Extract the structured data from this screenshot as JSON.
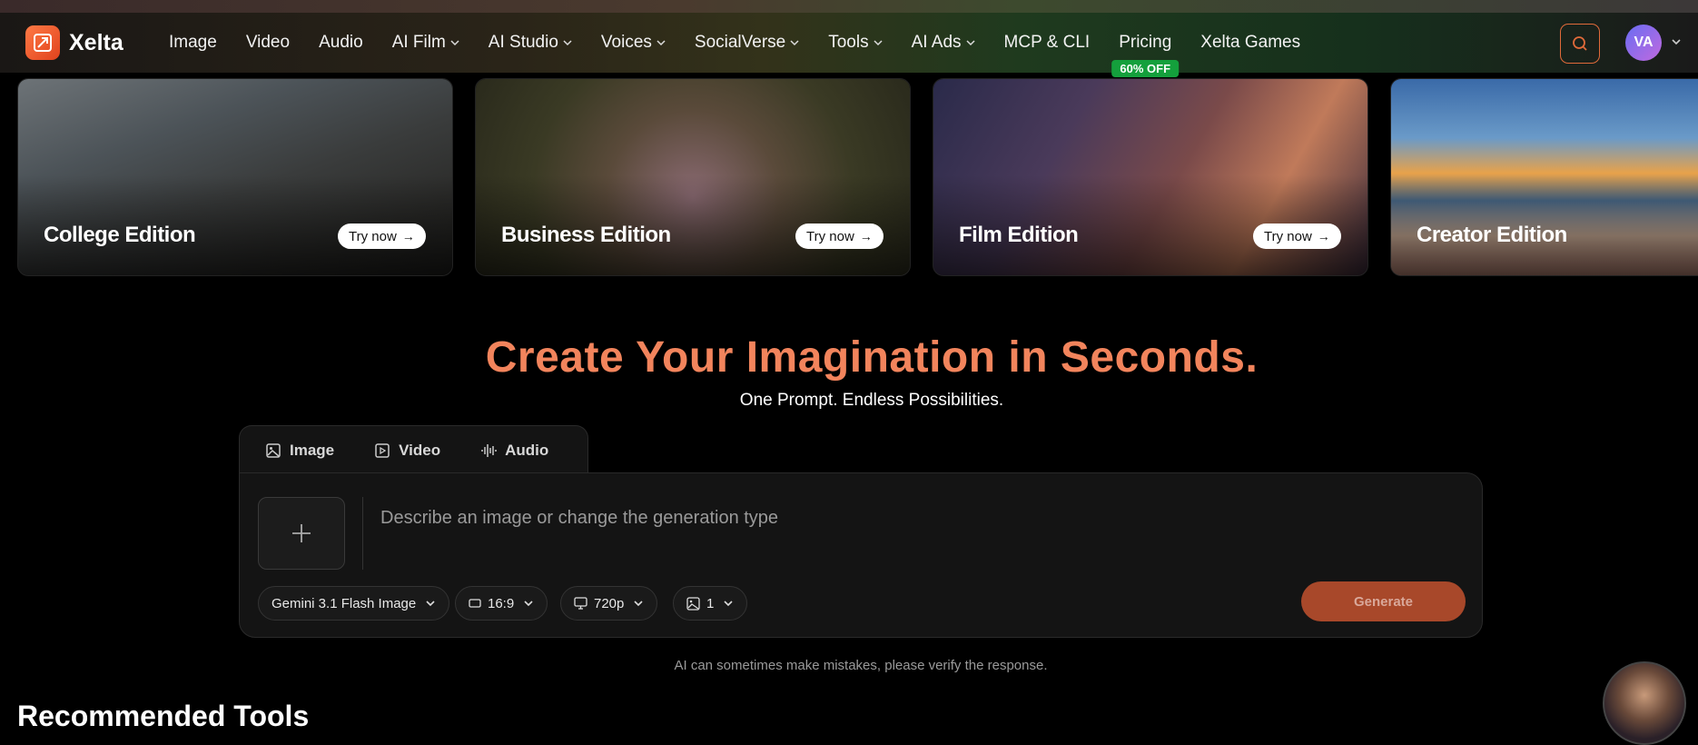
{
  "brand": {
    "name": "Xelta"
  },
  "nav": {
    "items": [
      {
        "label": "Image",
        "dropdown": false
      },
      {
        "label": "Video",
        "dropdown": false
      },
      {
        "label": "Audio",
        "dropdown": false
      },
      {
        "label": "AI Film",
        "dropdown": true
      },
      {
        "label": "AI Studio",
        "dropdown": true
      },
      {
        "label": "Voices",
        "dropdown": true
      },
      {
        "label": "SocialVerse",
        "dropdown": true
      },
      {
        "label": "Tools",
        "dropdown": true
      },
      {
        "label": "AI Ads",
        "dropdown": true
      },
      {
        "label": "MCP & CLI",
        "dropdown": false
      },
      {
        "label": "Pricing",
        "dropdown": false,
        "badge": "60% OFF"
      },
      {
        "label": "Xelta Games",
        "dropdown": false
      }
    ],
    "user_initials": "VA"
  },
  "cards": [
    {
      "title": "College Edition",
      "cta": "Try now"
    },
    {
      "title": "Business Edition",
      "cta": "Try now"
    },
    {
      "title": "Film Edition",
      "cta": "Try now"
    },
    {
      "title": "Creator Edition",
      "cta": ""
    }
  ],
  "hero": {
    "title": "Create Your Imagination in Seconds.",
    "subtitle": "One Prompt. Endless Possibilities."
  },
  "generator": {
    "tabs": [
      {
        "label": "Image",
        "icon": "image-icon"
      },
      {
        "label": "Video",
        "icon": "play-icon"
      },
      {
        "label": "Audio",
        "icon": "waveform-icon"
      }
    ],
    "prompt_placeholder": "Describe an image or change the generation type",
    "model": "Gemini 3.1 Flash Image",
    "aspect_ratio": "16:9",
    "resolution": "720p",
    "count": "1",
    "generate_label": "Generate"
  },
  "disclaimer": "AI can sometimes make mistakes, please verify the response.",
  "recommended_title": "Recommended Tools",
  "colors": {
    "accent": "#f2845c",
    "generate": "#a8482a",
    "badge": "#14a03c"
  }
}
